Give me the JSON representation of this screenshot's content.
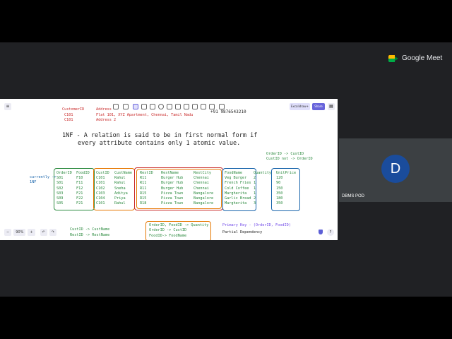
{
  "meet": {
    "brand": "Google Meet",
    "participant": {
      "initial": "D",
      "name": "DBMS POD"
    }
  },
  "toolbar": {
    "share": "Excalidraw+",
    "share2": "Share"
  },
  "board": {
    "customer": {
      "header_id": "CustomerID",
      "header_addr": "Address",
      "row1_id": "C101",
      "row1_addr": "Flat 101, XYZ Apartment, Chennai, Tamil Nadu",
      "row2_id": "C101",
      "row2_addr": "Address 2",
      "phone": "+91 9876543210"
    },
    "definition_line1": "1NF - A relation is said to be in first normal form if",
    "definition_line2": "every attribute contains only 1 atomic value.",
    "top_fds": [
      "OrderID -> CustID",
      "CustID not -> OrderID"
    ],
    "currently_label": "currently ->",
    "nf_label": "1NF",
    "table": {
      "OrderID": [
        "OrderID",
        "S01",
        "S01",
        "S02",
        "S03",
        "S09",
        "S05"
      ],
      "FoodID": [
        "FoodID",
        "F10",
        "F11",
        "F12",
        "F21",
        "F22",
        "F21"
      ],
      "CustID": [
        "CustID",
        "C101",
        "C101",
        "C102",
        "C103",
        "C104",
        "C101"
      ],
      "CustName": [
        "CustName",
        "Rahul",
        "Rahul",
        "Sneha",
        "Aditya",
        "Priya",
        "Rahul"
      ],
      "RestID": [
        "RestID",
        "R11",
        "R11",
        "R11",
        "R15",
        "R15",
        "R18"
      ],
      "RestName": [
        "RestName",
        "Burger Hub",
        "Burger Hub",
        "Burger Hub",
        "Pizza Town",
        "Pizza Town",
        "Pizza Town"
      ],
      "RestCity": [
        "RestCity",
        "Chennai",
        "Chennai",
        "Chennai",
        "Bangalore",
        "Bangalore",
        "Bangalore"
      ],
      "FoodName": [
        "FoodName",
        "Veg Burger",
        "French Fries",
        "Cold Coffee",
        "Margherita",
        "Garlic Bread",
        "Margherita"
      ],
      "Quantity": [
        "Quantity",
        "2",
        "1",
        "1",
        "1",
        "2",
        "3"
      ],
      "UnitPrice": [
        "UnitPrice",
        "120",
        "90",
        "150",
        "350",
        "180",
        "350"
      ]
    },
    "bottom_fds_left": [
      "CustID -> CustName",
      "RestID -> RestName"
    ],
    "bottom_fds_box": [
      "OrderID, FoodID -> Quantity",
      "OrderID -> CustID",
      "FoodID-> FoodName"
    ],
    "primary_key": "Primary Key - (OrderID, FoodID)",
    "partial_dep": "Partial Dependency"
  },
  "zoom": {
    "minus": "−",
    "level": "90%",
    "plus": "+",
    "undo": "↶",
    "redo": "↷"
  },
  "help": "?"
}
